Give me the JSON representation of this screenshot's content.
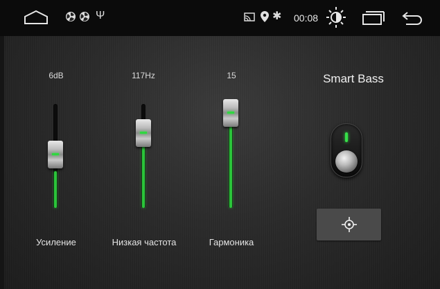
{
  "status_bar": {
    "time": "00:08",
    "usb_glyph": "Ψ",
    "bluetooth_glyph": "✱",
    "icons": [
      "home-icon",
      "fan-icon",
      "fan-icon",
      "usb-icon",
      "cast-icon",
      "location-pin-icon",
      "bluetooth-icon",
      "brightness-icon",
      "recents-icon",
      "back-icon"
    ]
  },
  "sliders": [
    {
      "value_text": "6dB",
      "label": "Усиление",
      "level": 0.35
    },
    {
      "value_text": "117Hz",
      "label": "Низкая частота",
      "level": 0.72
    },
    {
      "value_text": "15",
      "label": "Гармоника",
      "level": 1.0
    }
  ],
  "smart_bass": {
    "title": "Smart Bass",
    "enabled": true
  },
  "accent_color": "#2bc43a"
}
